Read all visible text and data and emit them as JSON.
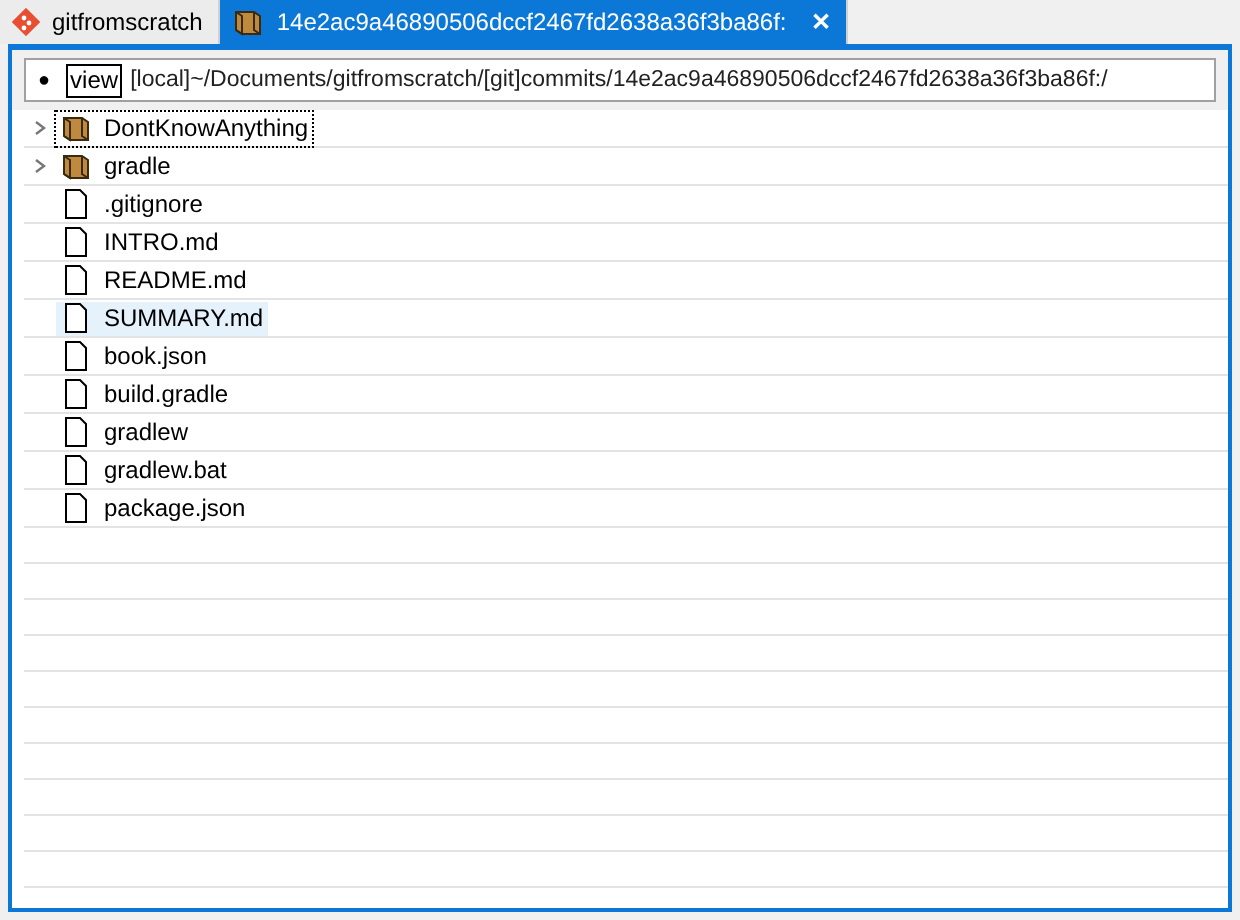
{
  "tabs": [
    {
      "label": "gitfromscratch",
      "kind": "repo",
      "selected": false,
      "closable": false
    },
    {
      "label": "14e2ac9a46890506dccf2467fd2638a36f3ba86f:",
      "kind": "commit",
      "selected": true,
      "closable": true,
      "close_glyph": "✕"
    }
  ],
  "address_bar": {
    "bullet": "●",
    "mode": "view",
    "path": "[local]~/Documents/gitfromscratch/[git]commits/14e2ac9a46890506dccf2467fd2638a36f3ba86f:/"
  },
  "tree": {
    "items": [
      {
        "name": "DontKnowAnything",
        "kind": "folder",
        "expanded": false,
        "focused": true,
        "selected": false
      },
      {
        "name": "gradle",
        "kind": "folder",
        "expanded": false,
        "focused": false,
        "selected": false
      },
      {
        "name": ".gitignore",
        "kind": "file",
        "focused": false,
        "selected": false
      },
      {
        "name": "INTRO.md",
        "kind": "file",
        "focused": false,
        "selected": false
      },
      {
        "name": "README.md",
        "kind": "file",
        "focused": false,
        "selected": false
      },
      {
        "name": "SUMMARY.md",
        "kind": "file",
        "focused": false,
        "selected": true
      },
      {
        "name": "book.json",
        "kind": "file",
        "focused": false,
        "selected": false
      },
      {
        "name": "build.gradle",
        "kind": "file",
        "focused": false,
        "selected": false
      },
      {
        "name": "gradlew",
        "kind": "file",
        "focused": false,
        "selected": false
      },
      {
        "name": "gradlew.bat",
        "kind": "file",
        "focused": false,
        "selected": false
      },
      {
        "name": "package.json",
        "kind": "file",
        "focused": false,
        "selected": false
      }
    ]
  }
}
